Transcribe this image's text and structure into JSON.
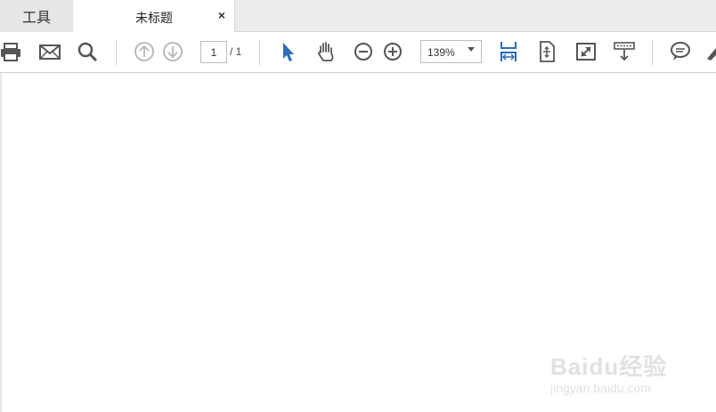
{
  "tabs": {
    "tools_label": "工具",
    "document_title": "未标题",
    "close_glyph": "×"
  },
  "toolbar": {
    "current_page": "1",
    "page_total": "/ 1",
    "zoom": "139%",
    "icons": [
      "print-icon",
      "email-icon",
      "search-icon",
      "prev-page-icon",
      "next-page-icon",
      "select-cursor-icon",
      "hand-icon",
      "zoom-out-icon",
      "zoom-in-icon",
      "fit-width-icon",
      "fit-page-icon",
      "fullscreen-icon",
      "scroll-mode-icon",
      "comment-icon",
      "sign-icon"
    ],
    "accent_color": "#2e6db4"
  },
  "watermark": {
    "brand": "Baidu经验",
    "url": "jingyan.baidu.com"
  }
}
